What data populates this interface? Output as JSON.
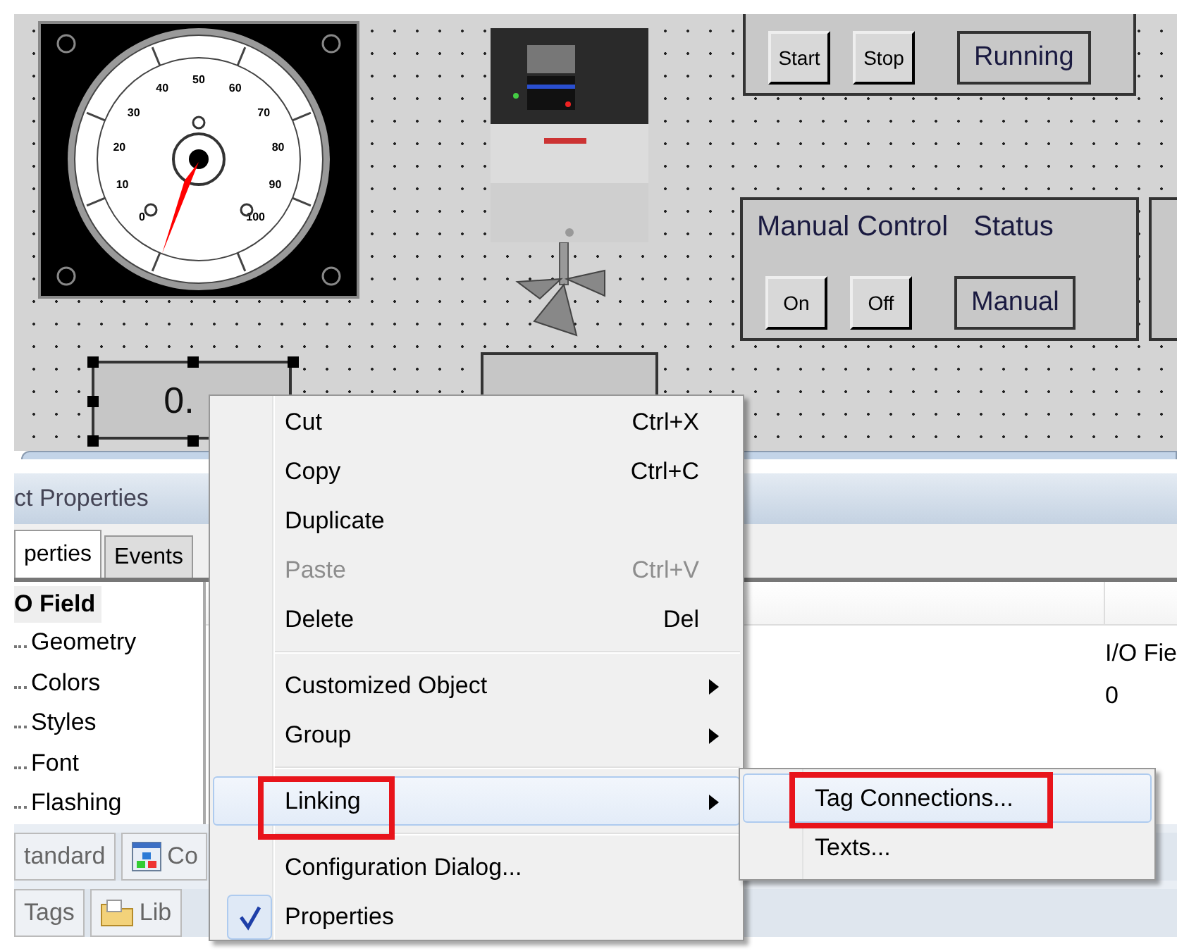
{
  "canvas": {
    "gauge": {
      "scale_labels": [
        "0",
        "10",
        "20",
        "30",
        "40",
        "50",
        "60",
        "70",
        "80",
        "90",
        "100"
      ]
    },
    "io_fields": [
      {
        "value": "0.",
        "selected": true
      },
      {
        "selected": false
      }
    ],
    "control_groups": [
      {
        "buttons": [
          "Start",
          "Stop"
        ],
        "status": "Running"
      },
      {
        "title": "Manual Control",
        "status_label": "Status",
        "buttons": [
          "On",
          "Off"
        ],
        "status": "Manual"
      }
    ]
  },
  "properties_panel": {
    "title": "ct Properties",
    "tabs": [
      {
        "label": "perties",
        "selected": true
      },
      {
        "label": "Events",
        "selected": false
      }
    ],
    "tree": {
      "label": "O Field",
      "selected": true,
      "children": [
        {
          "label": "Geometry",
          "selected": false
        },
        {
          "label": "Colors",
          "selected": false
        },
        {
          "label": "Styles",
          "selected": false
        },
        {
          "label": "Font",
          "selected": false
        },
        {
          "label": "Flashing",
          "selected": false
        }
      ]
    },
    "value_column": [
      "I/O Fie",
      "0"
    ],
    "bottom_tab_rows": [
      [
        {
          "label": "tandard",
          "kind": "plain"
        },
        {
          "label": "Co",
          "kind": "icon"
        }
      ],
      [
        {
          "label": "Tags",
          "kind": "plain"
        },
        {
          "label": "Lib",
          "kind": "icon"
        }
      ]
    ]
  },
  "context_menu": {
    "items": [
      {
        "kind": "item",
        "label": "Cut",
        "shortcut": "Ctrl+X",
        "disabled": false,
        "has_submenu": false,
        "selected": false,
        "checked": false,
        "outlined": false
      },
      {
        "kind": "item",
        "label": "Copy",
        "shortcut": "Ctrl+C",
        "disabled": false,
        "has_submenu": false,
        "selected": false,
        "checked": false,
        "outlined": false
      },
      {
        "kind": "item",
        "label": "Duplicate",
        "disabled": false,
        "has_submenu": false,
        "selected": false,
        "checked": false,
        "outlined": false
      },
      {
        "kind": "item",
        "label": "Paste",
        "shortcut": "Ctrl+V",
        "disabled": true,
        "has_submenu": false,
        "selected": false,
        "checked": false,
        "outlined": false
      },
      {
        "kind": "item",
        "label": "Delete",
        "shortcut": "Del",
        "disabled": false,
        "has_submenu": false,
        "selected": false,
        "checked": false,
        "outlined": false
      },
      {
        "kind": "separator"
      },
      {
        "kind": "item",
        "label": "Customized Object",
        "disabled": false,
        "has_submenu": true,
        "selected": false,
        "checked": false,
        "outlined": false
      },
      {
        "kind": "item",
        "label": "Group",
        "disabled": false,
        "has_submenu": true,
        "selected": false,
        "checked": false,
        "outlined": false
      },
      {
        "kind": "separator"
      },
      {
        "kind": "item",
        "label": "Linking",
        "disabled": false,
        "has_submenu": true,
        "selected": true,
        "checked": false,
        "outlined": true
      },
      {
        "kind": "separator"
      },
      {
        "kind": "item",
        "label": "Configuration Dialog...",
        "disabled": false,
        "has_submenu": false,
        "selected": false,
        "checked": false,
        "outlined": false
      },
      {
        "kind": "item",
        "label": "Properties",
        "disabled": false,
        "has_submenu": false,
        "selected": false,
        "checked": true,
        "outlined": false
      }
    ]
  },
  "submenu": {
    "items": [
      {
        "label": "Tag Connections...",
        "selected": true,
        "outlined": true
      },
      {
        "label": "Texts...",
        "selected": false,
        "outlined": false
      }
    ]
  }
}
